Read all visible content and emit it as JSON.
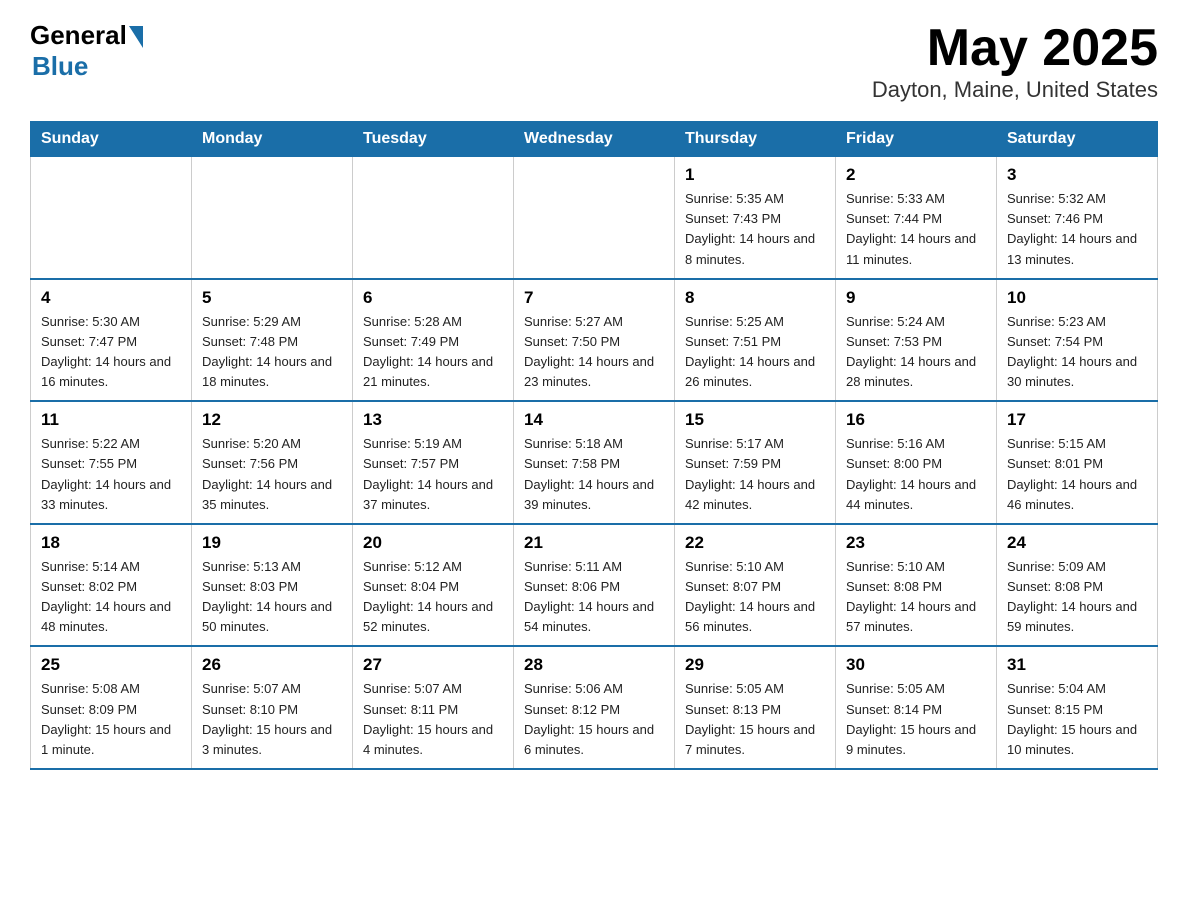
{
  "logo": {
    "general_text": "General",
    "blue_text": "Blue"
  },
  "title": "May 2025",
  "location": "Dayton, Maine, United States",
  "days_of_week": [
    "Sunday",
    "Monday",
    "Tuesday",
    "Wednesday",
    "Thursday",
    "Friday",
    "Saturday"
  ],
  "weeks": [
    [
      {
        "day": "",
        "info": ""
      },
      {
        "day": "",
        "info": ""
      },
      {
        "day": "",
        "info": ""
      },
      {
        "day": "",
        "info": ""
      },
      {
        "day": "1",
        "info": "Sunrise: 5:35 AM\nSunset: 7:43 PM\nDaylight: 14 hours and 8 minutes."
      },
      {
        "day": "2",
        "info": "Sunrise: 5:33 AM\nSunset: 7:44 PM\nDaylight: 14 hours and 11 minutes."
      },
      {
        "day": "3",
        "info": "Sunrise: 5:32 AM\nSunset: 7:46 PM\nDaylight: 14 hours and 13 minutes."
      }
    ],
    [
      {
        "day": "4",
        "info": "Sunrise: 5:30 AM\nSunset: 7:47 PM\nDaylight: 14 hours and 16 minutes."
      },
      {
        "day": "5",
        "info": "Sunrise: 5:29 AM\nSunset: 7:48 PM\nDaylight: 14 hours and 18 minutes."
      },
      {
        "day": "6",
        "info": "Sunrise: 5:28 AM\nSunset: 7:49 PM\nDaylight: 14 hours and 21 minutes."
      },
      {
        "day": "7",
        "info": "Sunrise: 5:27 AM\nSunset: 7:50 PM\nDaylight: 14 hours and 23 minutes."
      },
      {
        "day": "8",
        "info": "Sunrise: 5:25 AM\nSunset: 7:51 PM\nDaylight: 14 hours and 26 minutes."
      },
      {
        "day": "9",
        "info": "Sunrise: 5:24 AM\nSunset: 7:53 PM\nDaylight: 14 hours and 28 minutes."
      },
      {
        "day": "10",
        "info": "Sunrise: 5:23 AM\nSunset: 7:54 PM\nDaylight: 14 hours and 30 minutes."
      }
    ],
    [
      {
        "day": "11",
        "info": "Sunrise: 5:22 AM\nSunset: 7:55 PM\nDaylight: 14 hours and 33 minutes."
      },
      {
        "day": "12",
        "info": "Sunrise: 5:20 AM\nSunset: 7:56 PM\nDaylight: 14 hours and 35 minutes."
      },
      {
        "day": "13",
        "info": "Sunrise: 5:19 AM\nSunset: 7:57 PM\nDaylight: 14 hours and 37 minutes."
      },
      {
        "day": "14",
        "info": "Sunrise: 5:18 AM\nSunset: 7:58 PM\nDaylight: 14 hours and 39 minutes."
      },
      {
        "day": "15",
        "info": "Sunrise: 5:17 AM\nSunset: 7:59 PM\nDaylight: 14 hours and 42 minutes."
      },
      {
        "day": "16",
        "info": "Sunrise: 5:16 AM\nSunset: 8:00 PM\nDaylight: 14 hours and 44 minutes."
      },
      {
        "day": "17",
        "info": "Sunrise: 5:15 AM\nSunset: 8:01 PM\nDaylight: 14 hours and 46 minutes."
      }
    ],
    [
      {
        "day": "18",
        "info": "Sunrise: 5:14 AM\nSunset: 8:02 PM\nDaylight: 14 hours and 48 minutes."
      },
      {
        "day": "19",
        "info": "Sunrise: 5:13 AM\nSunset: 8:03 PM\nDaylight: 14 hours and 50 minutes."
      },
      {
        "day": "20",
        "info": "Sunrise: 5:12 AM\nSunset: 8:04 PM\nDaylight: 14 hours and 52 minutes."
      },
      {
        "day": "21",
        "info": "Sunrise: 5:11 AM\nSunset: 8:06 PM\nDaylight: 14 hours and 54 minutes."
      },
      {
        "day": "22",
        "info": "Sunrise: 5:10 AM\nSunset: 8:07 PM\nDaylight: 14 hours and 56 minutes."
      },
      {
        "day": "23",
        "info": "Sunrise: 5:10 AM\nSunset: 8:08 PM\nDaylight: 14 hours and 57 minutes."
      },
      {
        "day": "24",
        "info": "Sunrise: 5:09 AM\nSunset: 8:08 PM\nDaylight: 14 hours and 59 minutes."
      }
    ],
    [
      {
        "day": "25",
        "info": "Sunrise: 5:08 AM\nSunset: 8:09 PM\nDaylight: 15 hours and 1 minute."
      },
      {
        "day": "26",
        "info": "Sunrise: 5:07 AM\nSunset: 8:10 PM\nDaylight: 15 hours and 3 minutes."
      },
      {
        "day": "27",
        "info": "Sunrise: 5:07 AM\nSunset: 8:11 PM\nDaylight: 15 hours and 4 minutes."
      },
      {
        "day": "28",
        "info": "Sunrise: 5:06 AM\nSunset: 8:12 PM\nDaylight: 15 hours and 6 minutes."
      },
      {
        "day": "29",
        "info": "Sunrise: 5:05 AM\nSunset: 8:13 PM\nDaylight: 15 hours and 7 minutes."
      },
      {
        "day": "30",
        "info": "Sunrise: 5:05 AM\nSunset: 8:14 PM\nDaylight: 15 hours and 9 minutes."
      },
      {
        "day": "31",
        "info": "Sunrise: 5:04 AM\nSunset: 8:15 PM\nDaylight: 15 hours and 10 minutes."
      }
    ]
  ],
  "colors": {
    "header_bg": "#1a6ea8",
    "header_text": "#ffffff",
    "border": "#1a6ea8"
  }
}
